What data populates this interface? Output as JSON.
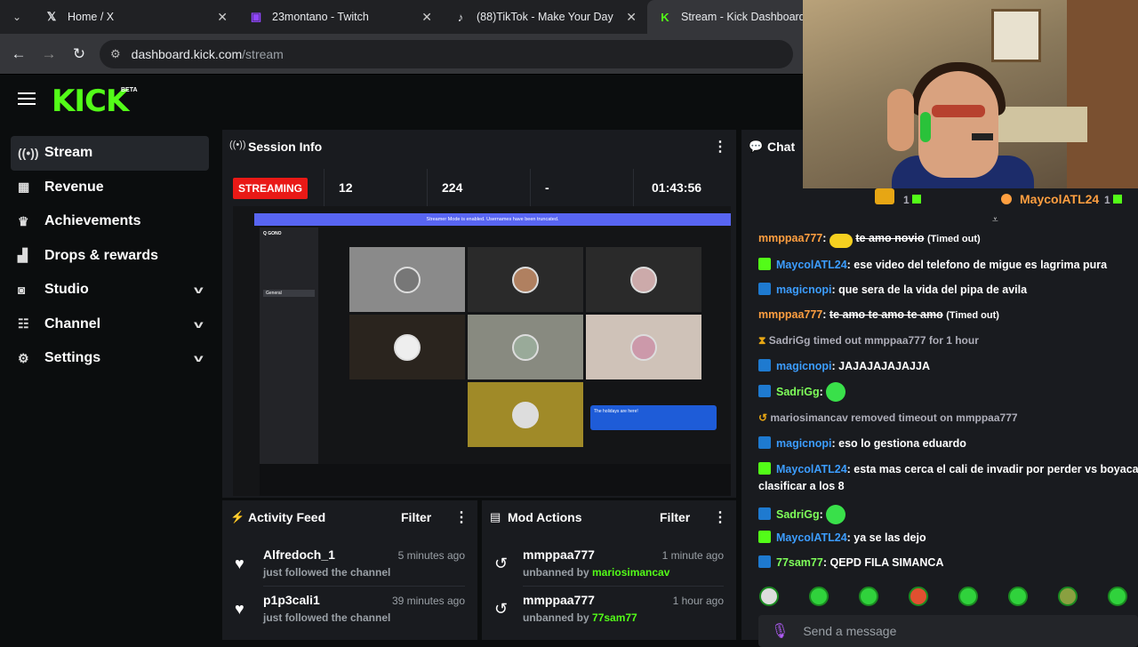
{
  "browser": {
    "tabs": [
      {
        "label": "Home / X",
        "icon": "x-logo-icon"
      },
      {
        "label": "23montano - Twitch",
        "icon": "twitch-icon"
      },
      {
        "label": "(88)TikTok - Make Your Day",
        "icon": "tiktok-icon"
      },
      {
        "label": "Stream - Kick Dashboard",
        "icon": "kick-icon"
      }
    ],
    "url_host": "dashboard.kick.com",
    "url_path": "/stream"
  },
  "brand": {
    "logo": "KICK",
    "beta": "BETA",
    "accent": "#53fc18"
  },
  "sidebar": {
    "items": [
      {
        "label": "Stream",
        "icon": "broadcast-icon"
      },
      {
        "label": "Revenue",
        "icon": "revenue-icon"
      },
      {
        "label": "Achievements",
        "icon": "trophy-icon"
      },
      {
        "label": "Drops & rewards",
        "icon": "drops-icon"
      },
      {
        "label": "Studio",
        "icon": "studio-icon"
      },
      {
        "label": "Channel",
        "icon": "channel-icon"
      },
      {
        "label": "Settings",
        "icon": "gear-icon"
      }
    ]
  },
  "session": {
    "title": "Session Info",
    "status": "STREAMING",
    "viewers": "12",
    "followers": "224",
    "dash": "-",
    "duration": "01:43:56"
  },
  "activity": {
    "title": "Activity Feed",
    "filter": "Filter",
    "items": [
      {
        "name": "Alfredoch_1",
        "sub": "just followed the channel",
        "time": "5 minutes ago"
      },
      {
        "name": "p1p3cali1",
        "sub": "just followed the channel",
        "time": "39 minutes ago"
      }
    ]
  },
  "mod": {
    "title": "Mod Actions",
    "filter": "Filter",
    "items": [
      {
        "name": "mmppaa777",
        "sub": "unbanned by",
        "by": "mariosimancav",
        "time": "1 minute ago"
      },
      {
        "name": "mmppaa777",
        "sub": "unbanned by",
        "by": "77sam77",
        "time": "1 hour ago"
      }
    ]
  },
  "chat": {
    "title": "Chat",
    "top_count_1": "1",
    "top_user": "MaycolATL24",
    "top_count_2": "1",
    "lines": [
      {
        "user": "mmppaa777",
        "msg": "te amo novio",
        "tag": "(Timed out)"
      },
      {
        "user": "MaycolATL24",
        "msg": "ese video del telefono de migue es lagrima pura"
      },
      {
        "user": "magicnopi",
        "msg": "que sera de la vida del pipa de avila"
      },
      {
        "user": "mmppaa777",
        "msg": "te amo te amo te amo",
        "tag": "(Timed out)"
      },
      {
        "system_user": "SadriGg",
        "system_text": "timed out",
        "target": "mmppaa777",
        "suffix": "for 1 hour"
      },
      {
        "user": "magicnopi",
        "msg": "JAJAJAJAJAJJA"
      },
      {
        "user": "SadriGg",
        "msg": ""
      },
      {
        "system_user": "mariosimancav",
        "system_text": "removed timeout on",
        "target": "mmppaa777"
      },
      {
        "user": "magicnopi",
        "msg": "eso lo gestiona eduardo"
      },
      {
        "user": "MaycolATL24",
        "msg": "esta mas cerca el cali de invadir por perder vs boyaca",
        "msg2": "clasificar a los 8"
      },
      {
        "user": "SadriGg",
        "msg": ""
      },
      {
        "user": "MaycolATL24",
        "msg": "ya se las dejo"
      },
      {
        "user": "77sam77",
        "msg": "QEPD FILA SIMANCA"
      }
    ],
    "placeholder": "Send a message"
  },
  "preview": {
    "banner": "Streamer Mode is enabled. Usernames have been truncated.",
    "server": "Q GONO",
    "channel": "General",
    "popup": "The holidays are here!"
  }
}
